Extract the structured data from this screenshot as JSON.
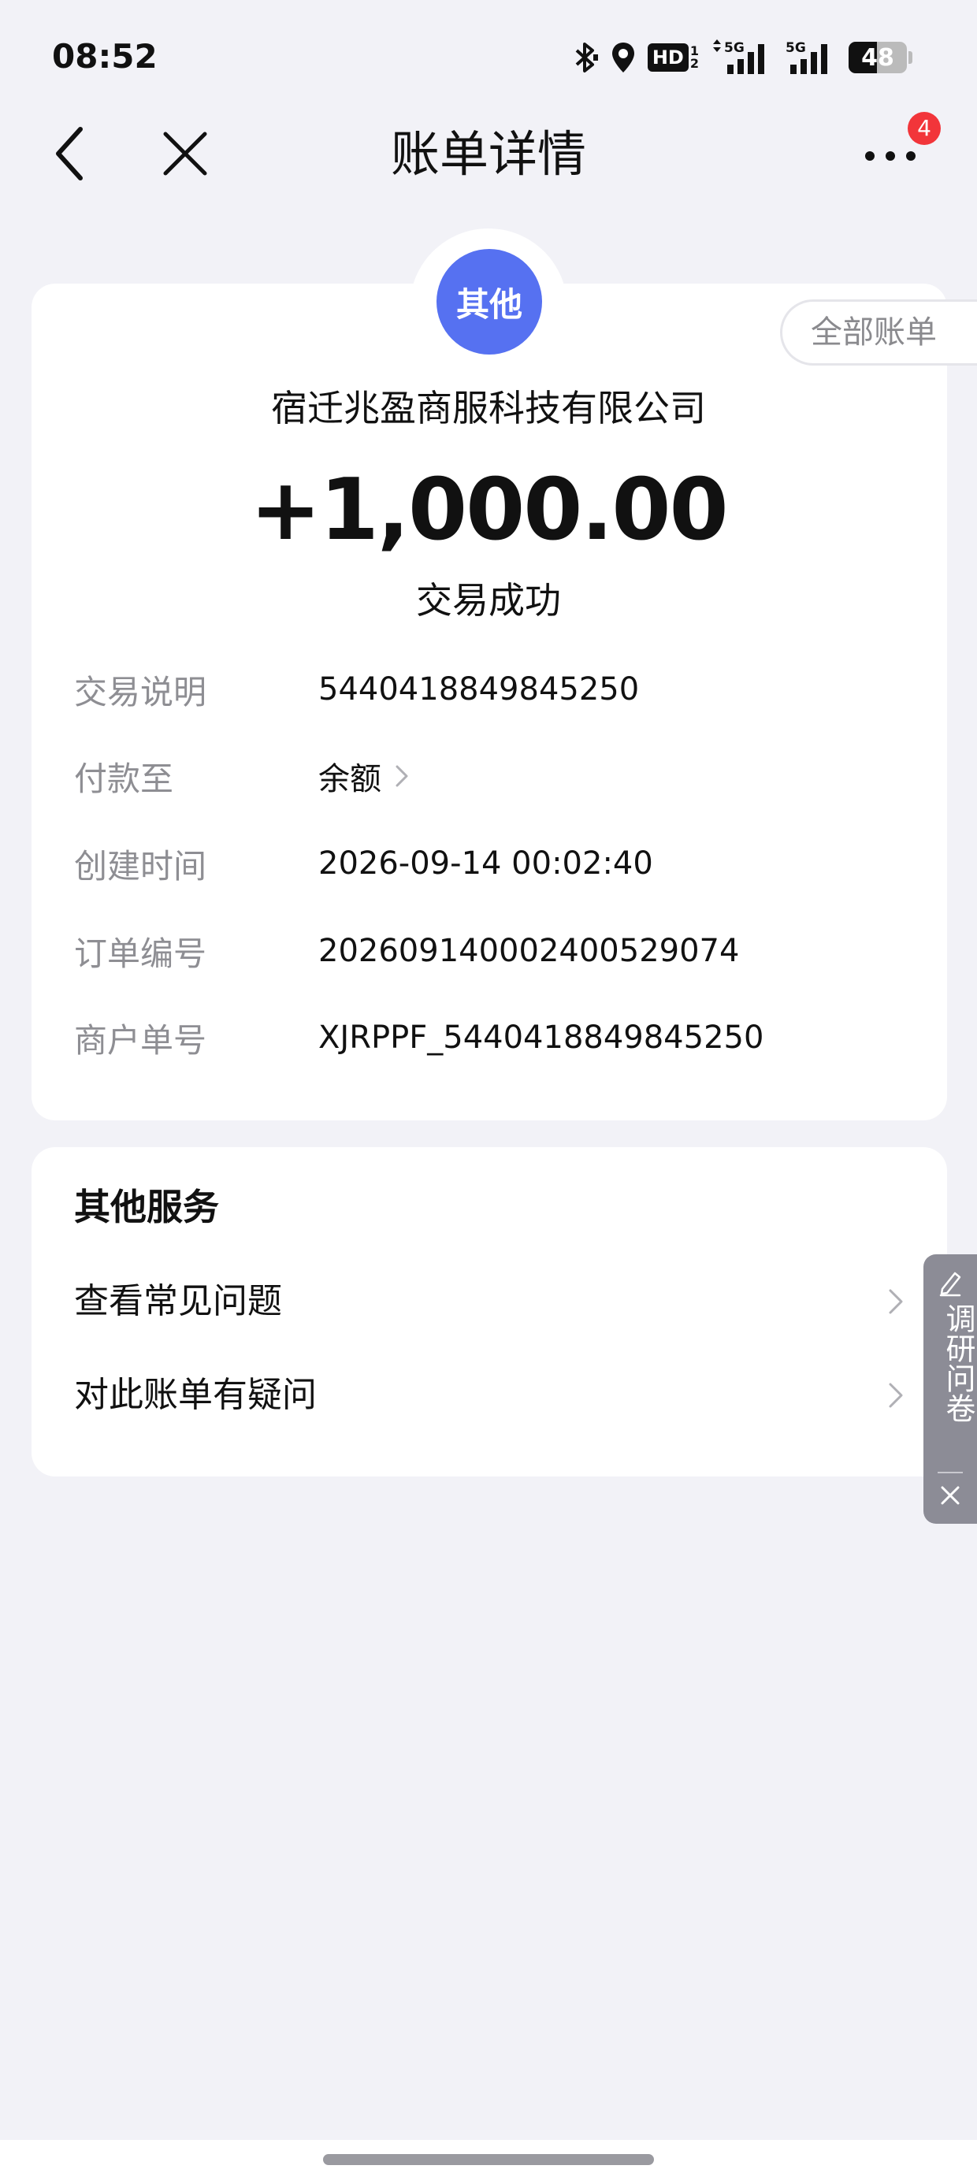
{
  "status_bar": {
    "time": "08:52",
    "hd_label": "HD",
    "hd_sub_top": "1",
    "hd_sub_bottom": "2",
    "network_1": "5G",
    "network_2": "5G",
    "battery": "48",
    "battery_level": 0.48
  },
  "nav": {
    "title": "账单详情",
    "more_badge": "4",
    "back_icon": "chevron-left-icon",
    "close_icon": "close-icon",
    "more_icon": "more-dots-icon"
  },
  "bill": {
    "category": "其他",
    "all_bills_label": "全部账单",
    "merchant": "宿迁兆盈商服科技有限公司",
    "amount": "+1,000.00",
    "status": "交易成功",
    "details": [
      {
        "label": "交易说明",
        "value": "5440418849845250"
      },
      {
        "label": "付款至",
        "value": "余额"
      },
      {
        "label": "创建时间",
        "value": "2026-09-14 00:02:40"
      },
      {
        "label": "订单编号",
        "value": "2026091400024005290​74"
      },
      {
        "label": "商户单号",
        "value": "XJRPPF_5440418849845250"
      }
    ]
  },
  "services": {
    "title": "其他服务",
    "items": [
      {
        "label": "查看常见问题"
      },
      {
        "label": "对此账单有疑问"
      }
    ]
  },
  "survey": {
    "label": "调研问卷"
  },
  "colors": {
    "background": "#f2f2f7",
    "category_blue": "#5671f1",
    "badge_red": "#f2353a",
    "label_gray": "#8e8e93"
  }
}
